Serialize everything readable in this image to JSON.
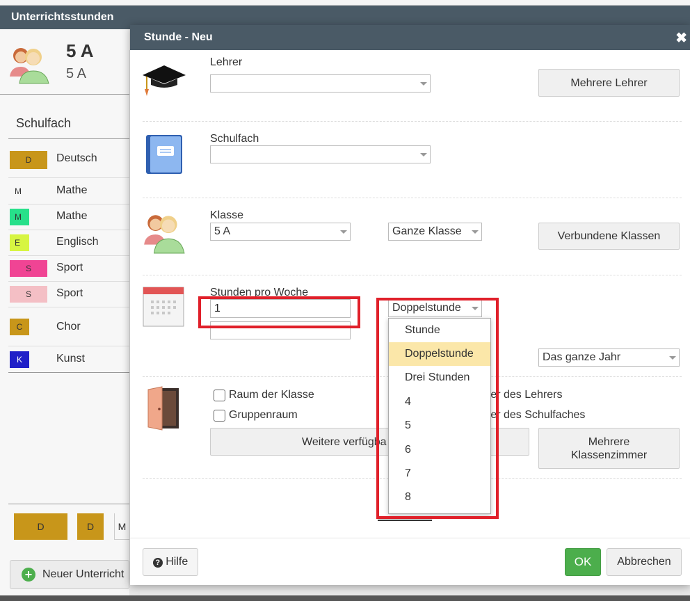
{
  "background": {
    "header_title": "Unterrichtsstunden",
    "class_name": "5 A",
    "class_sub": "5 A",
    "subject_header": "Schulfach",
    "subjects": [
      {
        "code": "D",
        "name": "Deutsch",
        "color": "#c8961a"
      },
      {
        "code": "M",
        "name": "Mathe",
        "color": "#f7f7f7"
      },
      {
        "code": "M",
        "name": "Mathe",
        "color": "#27e08a"
      },
      {
        "code": "E",
        "name": "Englisch",
        "color": "#d7f542"
      },
      {
        "code": "S",
        "name": "Sport",
        "color": "#f04494"
      },
      {
        "code": "S",
        "name": "Sport",
        "color": "#f4bfc5"
      },
      {
        "code": "C",
        "name": "Chor",
        "color": "#c8961a"
      },
      {
        "code": "K",
        "name": "Kunst",
        "color": "#2020c8"
      }
    ],
    "bottom_chips": [
      "D",
      "D",
      "M"
    ],
    "new_lesson_button": "Neuer Unterricht"
  },
  "dialog": {
    "title": "Stunde - Neu",
    "close_label": "✖",
    "teacher": {
      "label": "Lehrer",
      "value": "",
      "multi_button": "Mehrere Lehrer"
    },
    "subject": {
      "label": "Schulfach",
      "value": ""
    },
    "klasse": {
      "label": "Klasse",
      "value": "5 A",
      "group_value": "Ganze Klasse",
      "linked_button": "Verbundene Klassen"
    },
    "hours": {
      "label": "Stunden pro Woche",
      "value": "1",
      "second_value": "",
      "type_value": "Doppelstunde",
      "period_value": "Das ganze Jahr",
      "options": [
        "Stunde",
        "Doppelstunde",
        "Drei Stunden",
        "4",
        "5",
        "6",
        "7",
        "8"
      ],
      "selected_index": 1
    },
    "room": {
      "checkbox_class_room": "Raum der Klasse",
      "checkbox_group_room": "Gruppenraum",
      "checkbox_teacher_room_partial": "mer des Lehrers",
      "checkbox_subject_room_partial": "mer des Schulfaches",
      "more_available_partial": "Weitere verfügba",
      "multi_rooms_line1": "Mehrere",
      "multi_rooms_line2": "Klassenzimmer"
    },
    "footer": {
      "help": "Hilfe",
      "ok": "OK",
      "cancel": "Abbrechen"
    }
  },
  "colors": {
    "header_bg": "#4a5a66",
    "ok_green": "#4cae4c",
    "highlight_red": "#e0202a",
    "selected_option": "#fbe7a9"
  }
}
